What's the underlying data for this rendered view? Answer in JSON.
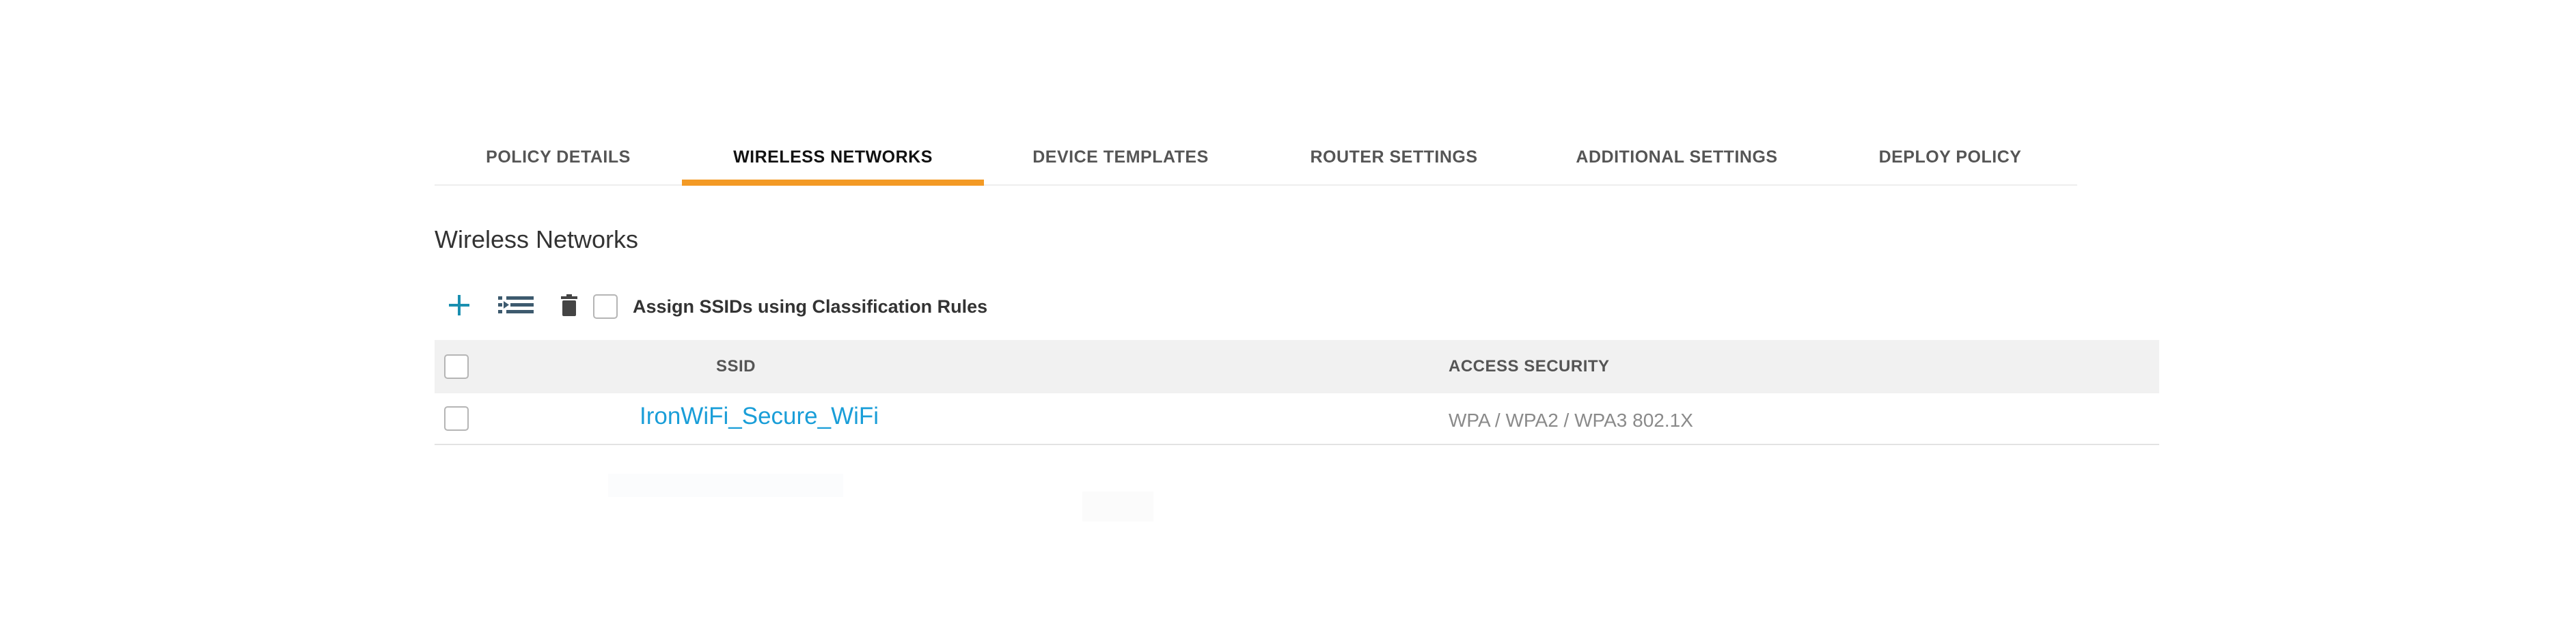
{
  "tabs": [
    {
      "label": "POLICY DETAILS",
      "active": false
    },
    {
      "label": "WIRELESS NETWORKS",
      "active": true
    },
    {
      "label": "DEVICE TEMPLATES",
      "active": false
    },
    {
      "label": "ROUTER SETTINGS",
      "active": false
    },
    {
      "label": "ADDITIONAL SETTINGS",
      "active": false
    },
    {
      "label": "DEPLOY POLICY",
      "active": false
    }
  ],
  "section": {
    "title": "Wireless Networks"
  },
  "toolbar": {
    "add_icon": "plus-icon",
    "classify_icon": "list-arrow-icon",
    "delete_icon": "trash-icon",
    "assign_label": "Assign SSIDs using Classification Rules",
    "assign_checked": false
  },
  "table": {
    "columns": [
      "SSID",
      "ACCESS SECURITY"
    ],
    "rows": [
      {
        "ssid": "IronWiFi_Secure_WiFi",
        "access_security": "WPA / WPA2 / WPA3 802.1X",
        "checked": false
      }
    ]
  },
  "colors": {
    "accent_tab": "#f39a25",
    "link": "#1a9ed8",
    "icon_teal": "#1a8fb0",
    "header_bg": "#f1f1f1"
  }
}
